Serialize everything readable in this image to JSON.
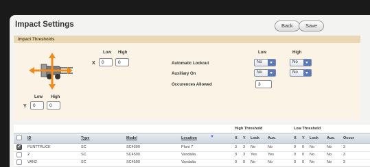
{
  "page": {
    "title": "Impact Settings"
  },
  "toolbar": {
    "back_label": "Back",
    "save_label": "Save"
  },
  "thresholds": {
    "section_label": "Impact Thresholds",
    "x_axis": {
      "label": "X",
      "low_label": "Low",
      "high_label": "High",
      "low_value": "0",
      "high_value": "0"
    },
    "y_axis": {
      "label": "Y",
      "low_label": "Low",
      "high_label": "High",
      "low_value": "0",
      "high_value": "0"
    },
    "settings_low_header": "Low",
    "settings_high_header": "High",
    "automatic_lockout": {
      "label": "Automatic Lockout",
      "low": "No",
      "high": "No"
    },
    "auxiliary_on": {
      "label": "Auxiliary On",
      "low": "No",
      "high": "No"
    },
    "occurrences_allowed": {
      "label": "Occurences Allowed",
      "value": "3"
    }
  },
  "table": {
    "group_headers": {
      "high": "High Threshold",
      "low": "Low Threshold"
    },
    "columns": {
      "id": "ID",
      "type": "Type",
      "model": "Model",
      "location": "Location",
      "hx": "X",
      "hy": "Y",
      "hlock": "Lock",
      "haux": "Aux.",
      "lx": "X",
      "ly": "Y",
      "llock": "Lock",
      "laux": "Aux.",
      "occur": "Occur"
    },
    "rows": [
      {
        "checked": true,
        "id": "FUNTTRUCK",
        "type": "SC",
        "model": "SC4500",
        "location": "Plant 7",
        "hx": "3",
        "hy": "3",
        "hlock": "No",
        "haux": "No",
        "lx": "0",
        "ly": "0",
        "llock": "No",
        "laux": "No",
        "occur": "3"
      },
      {
        "checked": false,
        "id": "2",
        "type": "SC",
        "model": "SC4500",
        "location": "Vandalia",
        "hx": "3",
        "hy": "3",
        "hlock": "Yes",
        "haux": "Yes",
        "lx": "0",
        "ly": "0",
        "llock": "No",
        "laux": "No",
        "occur": "3"
      },
      {
        "checked": false,
        "id": "VAN2",
        "type": "SC",
        "model": "SC4500",
        "location": "Vandalia",
        "hx": "0",
        "hy": "0",
        "hlock": "No",
        "haux": "No",
        "lx": "0",
        "ly": "0",
        "llock": "No",
        "laux": "No",
        "occur": "3"
      }
    ]
  },
  "colors": {
    "accent_orange": "#f28a1e",
    "panel_bg": "#fbf4e6",
    "select_blue": "#5b78b8"
  }
}
